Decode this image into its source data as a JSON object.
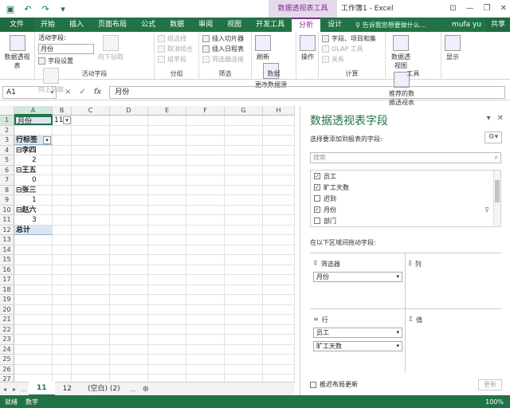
{
  "window": {
    "context_tool": "数据透视表工具",
    "title": "工作簿1 - Excel",
    "qat": [
      "save-icon",
      "undo-icon",
      "redo-icon",
      "customize-icon"
    ],
    "controls": [
      "ribbon-display-icon",
      "minimize-icon",
      "restore-icon",
      "close-icon"
    ]
  },
  "tabs": {
    "file": "文件",
    "items": [
      "开始",
      "插入",
      "页面布局",
      "公式",
      "数据",
      "审阅",
      "视图",
      "开发工具"
    ],
    "ctx_active": "分析",
    "ctx_other": "设计",
    "tell_me": "♀ 告诉我您想要做什么...",
    "user": "mufa yu",
    "share": "共享"
  },
  "ribbon": {
    "pivot": {
      "label": "数据透视表",
      "group_label": ""
    },
    "active_field": {
      "title": "活动字段:",
      "value": "月份",
      "settings": "字段设置",
      "drill_down": "向下钻取",
      "drill_up": "向上钻取",
      "group_label": "活动字段"
    },
    "group": {
      "items": [
        "组选择",
        "取消组合",
        "组字段"
      ],
      "group_label": "分组"
    },
    "filter": {
      "items": [
        "插入切片器",
        "插入日程表",
        "筛选器连接"
      ],
      "group_label": "筛选"
    },
    "data": {
      "refresh": "刷新",
      "change_source": "更改数据源",
      "group_label": "数据"
    },
    "actions": {
      "label": "操作"
    },
    "calc": {
      "items": [
        "字段、项目和集",
        "OLAP 工具",
        "关系"
      ],
      "group_label": "计算"
    },
    "tools": {
      "pivotchart": "数据透视图",
      "recommended": "推荐的数据透视表",
      "group_label": "工具"
    },
    "show": {
      "label": "显示"
    }
  },
  "formula": {
    "namebox": "A1",
    "fx": "fx",
    "cancel": "×",
    "enter": "✓",
    "content": "月份"
  },
  "grid": {
    "columns": [
      "A",
      "B",
      "C",
      "D",
      "E",
      "F",
      "G",
      "H"
    ],
    "rows": [
      "1",
      "2",
      "3",
      "4",
      "5",
      "6",
      "7",
      "8",
      "9",
      "10",
      "11",
      "12",
      "13",
      "14",
      "15",
      "16",
      "17",
      "18",
      "19",
      "20",
      "21",
      "22",
      "23",
      "24",
      "25",
      "26",
      "27"
    ],
    "a1": "月份",
    "b1": "11",
    "a3": "行标签",
    "a4": "⊟李四",
    "a5": "2",
    "a6": "⊟王五",
    "a7": "0",
    "a8": "⊟张三",
    "a9": "1",
    "a10": "⊟赵六",
    "a11": "3",
    "a12": "总计"
  },
  "sheets": {
    "tabs": [
      "11",
      "12",
      "(空白) (2)"
    ],
    "active": "11",
    "ellipsis": "...",
    "add": "⊕"
  },
  "status": {
    "ready": "就绪",
    "numlock": "数字",
    "zoom": "100%"
  },
  "pane": {
    "title": "数据透视表字段",
    "subtitle": "选择要添加到报表的字段:",
    "search_placeholder": "搜索",
    "fields": [
      {
        "name": "员工",
        "checked": true
      },
      {
        "name": "旷工天数",
        "checked": true
      },
      {
        "name": "迟到",
        "checked": false
      },
      {
        "name": "月份",
        "checked": true
      },
      {
        "name": "部门",
        "checked": false
      }
    ],
    "drag_note": "在以下区域间拖动字段:",
    "filters_label": "筛选器",
    "columns_label": "列",
    "rows_label": "行",
    "values_label": "值",
    "filters_items": [
      "月份"
    ],
    "rows_items": [
      "员工",
      "旷工天数"
    ],
    "defer": "推迟布局更新",
    "update": "更新"
  }
}
